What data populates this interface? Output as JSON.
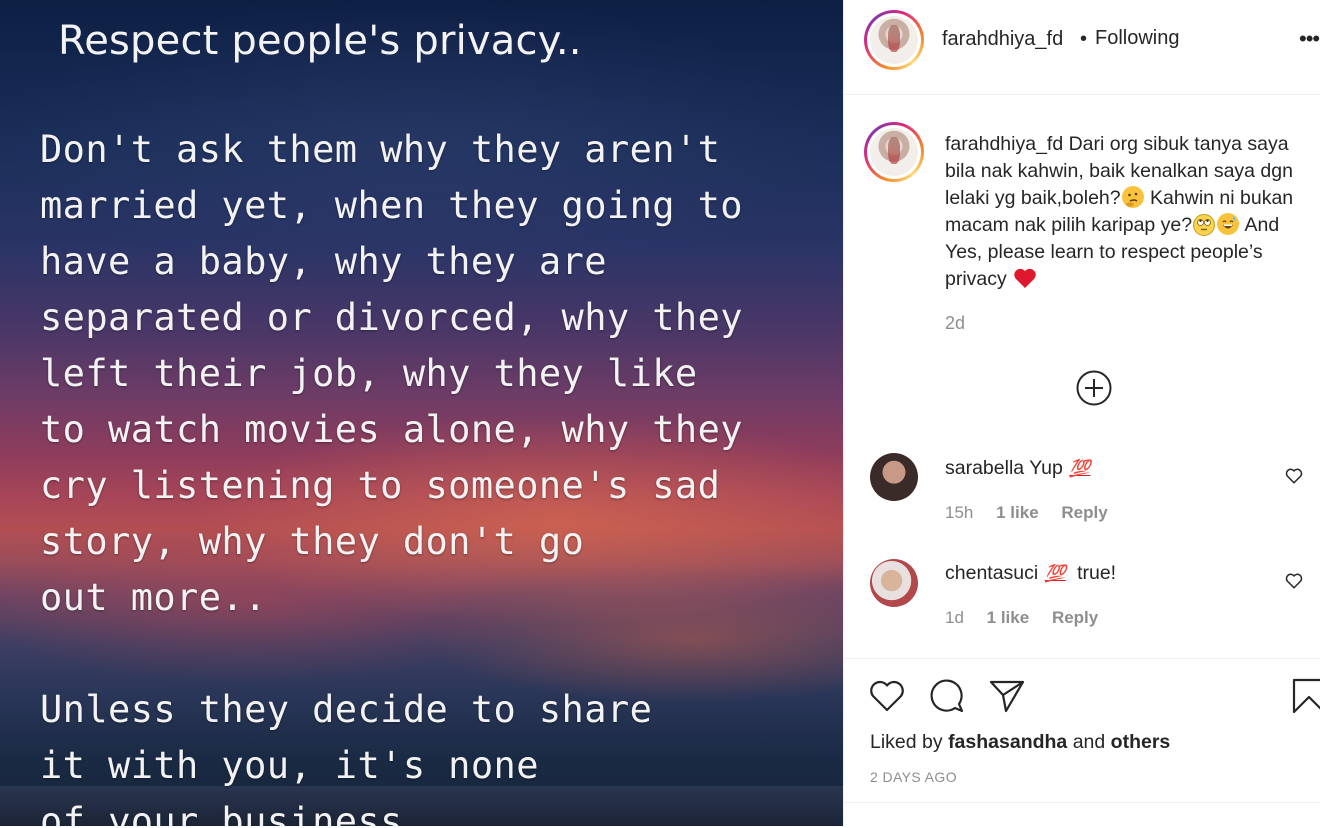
{
  "post_image": {
    "headline": "Respect people's privacy..",
    "body_lines": [
      "Don't ask them why they aren't",
      "married yet, when they going to",
      "have a baby, why they are",
      "separated or divorced, why they",
      "left their job, why they like",
      "to watch movies alone, why they",
      "cry listening to someone's sad",
      "story, why they don't go",
      "out more..",
      "Unless they decide to share",
      "it with you, it's none",
      "of your business...."
    ]
  },
  "header": {
    "username": "farahdhiya_fd",
    "separator": "•",
    "follow_status": "Following",
    "more_label": "•••"
  },
  "caption": {
    "username": "farahdhiya_fd",
    "part1": "Dari org sibuk tanya saya bila nak kahwin, baik kenalkan saya dgn lelaki yg baik,boleh?",
    "part2": "Kahwin ni bukan macam nak pilih karipap ye?",
    "part3": "And Yes, please learn to respect people’s privacy",
    "time": "2d",
    "emoji_icons": [
      "thinking-face-icon",
      "face-with-rolling-eyes-icon",
      "grinning-sweat-icon",
      "red-heart-icon"
    ]
  },
  "comments": [
    {
      "username": "sarabella",
      "text": "Yup",
      "emoji": "💯",
      "time": "15h",
      "likes": "1 like",
      "reply": "Reply"
    },
    {
      "username": "chentasuci",
      "text": "true!",
      "emoji": "💯",
      "time": "1d",
      "likes": "1 like",
      "reply": "Reply"
    }
  ],
  "footer": {
    "liked_prefix": "Liked by",
    "liked_user": "fashasandha",
    "liked_and": "and",
    "liked_others": "others",
    "date": "2 DAYS AGO"
  },
  "colors": {
    "text": "#262626",
    "muted": "#8e8e8e",
    "heart_red": "#ed4956",
    "border": "#efefef"
  }
}
